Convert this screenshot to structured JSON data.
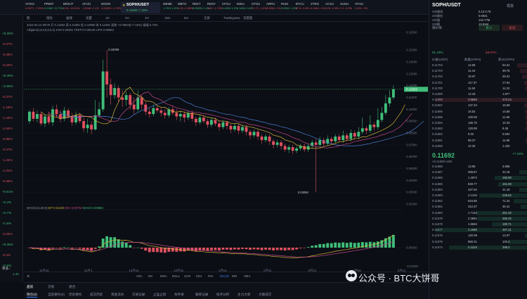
{
  "tabs": [
    {
      "name": "AITKO",
      "chg": "0.0971 -7.59%",
      "active": false
    },
    {
      "name": "PRIMT",
      "chg": "0.1462 +0.71%",
      "active": false
    },
    {
      "name": "BRZUT",
      "chg": "0.00 -13.91%",
      "active": false
    },
    {
      "name": "ATA/U",
      "chg": "1.3048 -1.1%",
      "active": false
    },
    {
      "name": "MOON",
      "chg": "0.00293 -1.79%",
      "active": false
    },
    {
      "name": "SOPH/USDT",
      "chg": "0.11692 7.16%",
      "active": true
    },
    {
      "name": "MEME",
      "chg": "1.76% 1.0%",
      "active": false
    },
    {
      "name": "MBTO",
      "chg": "1.25 -0.38%",
      "active": false
    },
    {
      "name": "REKT",
      "chg": "0.55000 1.4%",
      "active": false
    },
    {
      "name": "RENY",
      "chg": "1.10 -1.79%",
      "active": false
    },
    {
      "name": "CFXU",
      "chg": "1.4094 1.2%",
      "active": false
    },
    {
      "name": "IMSU",
      "chg": "1.1604 1.6%",
      "active": false
    },
    {
      "name": "OTOU",
      "chg": "71.71 -1.0%",
      "active": false
    },
    {
      "name": "ARPU",
      "chg": "0.0004 -1%",
      "active": false
    },
    {
      "name": "RUM",
      "chg": "0.3002 1.0%",
      "active": false
    },
    {
      "name": "BTCU",
      "chg": "87.6 -0.6%",
      "active": false
    },
    {
      "name": "STRO",
      "chg": "0.0481 -1%",
      "active": false
    },
    {
      "name": "ACXU",
      "chg": "0.01 -0.8%",
      "active": false
    },
    {
      "name": "SUSU",
      "chg": "1.1 -0.9%",
      "active": false
    },
    {
      "name": "ATA/U",
      "chg": "0.001 -2%",
      "active": false
    }
  ],
  "pair": {
    "name": "SOPH/USDT",
    "price": "0.11692",
    "change": "7.16%"
  },
  "left_list": [
    "+0.28%",
    "-0.37%",
    "-0.48%",
    "-0.22%",
    "+0.45%",
    "+2.85%",
    "-0.37%",
    "-1.16%",
    "-1.44%",
    "-1.64%",
    "-0.95%",
    "-0.27%",
    "-1.22%",
    "-1.01%",
    "-0.35%",
    "+0.61%",
    "+2.4%",
    "+2.7%",
    "+1.8%",
    "-0.42%",
    "+0.35%",
    "-0.4%",
    "+2.6%"
  ],
  "left_bottom": {
    "label": "参多↓",
    "value": "1.41"
  },
  "toolbar": {
    "items": [
      "图",
      "指标",
      "画线",
      "设置",
      "1D",
      "4H",
      "1H",
      "15m",
      "5m",
      "全屏",
      "Tradingview",
      "深度图"
    ]
  },
  "ohlc": {
    "line1": "2024-03-12 09:00  开 0.11692  高 0.11692  低 0.10980  收 0.11692  涨跌 +0.00833(+7.16%)  振幅 5.73%",
    "line2": "Alligator(13,8,5,8,5,3)  JAW 0.09481  TEETH 0.09126  LIPS 0.09663"
  },
  "chart_data": {
    "type": "candlestick",
    "ylabels": [
      "0.16500",
      "0.15000",
      "0.14000",
      "0.13000",
      "0.12000",
      "0.11000",
      "0.10000",
      "0.09000",
      "0.08000",
      "0.07000",
      "0.06000",
      "0.05000",
      "0.04000",
      "0.03000",
      "0.02000"
    ],
    "xlabels": [
      "11月16",
      "12月1",
      "12月16",
      "12月31",
      "1月16",
      "1月31",
      "2月14",
      "2月26",
      "3月12"
    ],
    "high_label": "0.15009",
    "low_label": "0.03050",
    "last_price": "0.11692",
    "candles": [
      [
        0.09,
        0.098,
        0.088,
        0.099
      ],
      [
        0.098,
        0.092,
        0.09,
        0.101
      ],
      [
        0.092,
        0.096,
        0.089,
        0.099
      ],
      [
        0.096,
        0.088,
        0.086,
        0.098
      ],
      [
        0.088,
        0.094,
        0.085,
        0.096
      ],
      [
        0.094,
        0.089,
        0.087,
        0.097
      ],
      [
        0.089,
        0.1,
        0.086,
        0.103
      ],
      [
        0.1,
        0.096,
        0.093,
        0.104
      ],
      [
        0.096,
        0.092,
        0.089,
        0.099
      ],
      [
        0.092,
        0.099,
        0.09,
        0.102
      ],
      [
        0.099,
        0.094,
        0.092,
        0.101
      ],
      [
        0.094,
        0.089,
        0.086,
        0.097
      ],
      [
        0.089,
        0.095,
        0.087,
        0.098
      ],
      [
        0.095,
        0.09,
        0.088,
        0.097
      ],
      [
        0.09,
        0.084,
        0.081,
        0.093
      ],
      [
        0.084,
        0.087,
        0.08,
        0.092
      ],
      [
        0.087,
        0.083,
        0.079,
        0.09
      ],
      [
        0.083,
        0.095,
        0.082,
        0.108
      ],
      [
        0.095,
        0.1,
        0.093,
        0.106
      ],
      [
        0.1,
        0.132,
        0.098,
        0.142
      ],
      [
        0.132,
        0.121,
        0.11,
        0.15
      ],
      [
        0.121,
        0.112,
        0.104,
        0.126
      ],
      [
        0.112,
        0.118,
        0.109,
        0.122
      ],
      [
        0.118,
        0.11,
        0.106,
        0.12
      ],
      [
        0.11,
        0.108,
        0.102,
        0.116
      ],
      [
        0.108,
        0.112,
        0.103,
        0.115
      ],
      [
        0.112,
        0.104,
        0.1,
        0.114
      ],
      [
        0.104,
        0.1,
        0.096,
        0.11
      ],
      [
        0.1,
        0.11,
        0.098,
        0.116
      ],
      [
        0.11,
        0.104,
        0.1,
        0.112
      ],
      [
        0.104,
        0.098,
        0.095,
        0.106
      ],
      [
        0.098,
        0.096,
        0.093,
        0.101
      ],
      [
        0.096,
        0.101,
        0.094,
        0.104
      ],
      [
        0.101,
        0.099,
        0.097,
        0.103
      ],
      [
        0.099,
        0.097,
        0.094,
        0.102
      ],
      [
        0.097,
        0.095,
        0.092,
        0.1
      ],
      [
        0.095,
        0.1,
        0.093,
        0.102
      ],
      [
        0.1,
        0.097,
        0.095,
        0.103
      ],
      [
        0.097,
        0.094,
        0.091,
        0.1
      ],
      [
        0.094,
        0.096,
        0.09,
        0.099
      ],
      [
        0.096,
        0.093,
        0.089,
        0.098
      ],
      [
        0.093,
        0.097,
        0.091,
        0.099
      ],
      [
        0.097,
        0.092,
        0.09,
        0.099
      ],
      [
        0.092,
        0.089,
        0.086,
        0.094
      ],
      [
        0.089,
        0.093,
        0.087,
        0.096
      ],
      [
        0.093,
        0.09,
        0.088,
        0.095
      ],
      [
        0.09,
        0.087,
        0.084,
        0.092
      ],
      [
        0.087,
        0.091,
        0.085,
        0.093
      ],
      [
        0.091,
        0.088,
        0.086,
        0.093
      ],
      [
        0.088,
        0.085,
        0.082,
        0.09
      ],
      [
        0.085,
        0.089,
        0.083,
        0.091
      ],
      [
        0.089,
        0.086,
        0.083,
        0.09
      ],
      [
        0.086,
        0.083,
        0.08,
        0.088
      ],
      [
        0.083,
        0.086,
        0.081,
        0.088
      ],
      [
        0.086,
        0.082,
        0.079,
        0.088
      ],
      [
        0.082,
        0.085,
        0.08,
        0.087
      ],
      [
        0.085,
        0.081,
        0.078,
        0.087
      ],
      [
        0.081,
        0.078,
        0.075,
        0.083
      ],
      [
        0.078,
        0.081,
        0.076,
        0.083
      ],
      [
        0.081,
        0.077,
        0.074,
        0.083
      ],
      [
        0.077,
        0.074,
        0.071,
        0.079
      ],
      [
        0.074,
        0.077,
        0.072,
        0.079
      ],
      [
        0.077,
        0.073,
        0.07,
        0.079
      ],
      [
        0.073,
        0.07,
        0.067,
        0.075
      ],
      [
        0.07,
        0.072,
        0.068,
        0.074
      ],
      [
        0.072,
        0.069,
        0.066,
        0.074
      ],
      [
        0.069,
        0.066,
        0.064,
        0.071
      ],
      [
        0.066,
        0.068,
        0.063,
        0.07
      ],
      [
        0.068,
        0.065,
        0.062,
        0.07
      ],
      [
        0.065,
        0.067,
        0.063,
        0.069
      ],
      [
        0.067,
        0.069,
        0.065,
        0.071
      ],
      [
        0.069,
        0.066,
        0.064,
        0.071
      ],
      [
        0.066,
        0.069,
        0.064,
        0.071
      ],
      [
        0.069,
        0.072,
        0.067,
        0.074
      ],
      [
        0.072,
        0.07,
        0.03,
        0.075
      ],
      [
        0.07,
        0.074,
        0.068,
        0.077
      ],
      [
        0.074,
        0.071,
        0.069,
        0.076
      ],
      [
        0.071,
        0.075,
        0.069,
        0.078
      ],
      [
        0.075,
        0.073,
        0.07,
        0.077
      ],
      [
        0.073,
        0.077,
        0.071,
        0.079
      ],
      [
        0.077,
        0.074,
        0.072,
        0.079
      ],
      [
        0.074,
        0.078,
        0.072,
        0.082
      ],
      [
        0.078,
        0.075,
        0.073,
        0.08
      ],
      [
        0.075,
        0.08,
        0.073,
        0.083
      ],
      [
        0.08,
        0.077,
        0.074,
        0.082
      ],
      [
        0.077,
        0.081,
        0.075,
        0.085
      ],
      [
        0.081,
        0.084,
        0.079,
        0.093
      ],
      [
        0.084,
        0.082,
        0.079,
        0.086
      ],
      [
        0.082,
        0.087,
        0.08,
        0.095
      ],
      [
        0.087,
        0.085,
        0.082,
        0.089
      ],
      [
        0.085,
        0.091,
        0.083,
        0.101
      ],
      [
        0.091,
        0.097,
        0.089,
        0.102
      ],
      [
        0.097,
        0.105,
        0.095,
        0.112
      ],
      [
        0.105,
        0.11,
        0.102,
        0.116
      ],
      [
        0.11,
        0.117,
        0.108,
        0.12
      ]
    ],
    "macd": {
      "label": "MACD(12,26,9)",
      "dif": "DIF 0.01193",
      "dea": "DEA 0.00762",
      "macd": "MACD 0.00863",
      "axis": [
        "0.00000",
        "-0.01000"
      ]
    }
  },
  "indicators": {
    "items": [
      "VOL",
      "MA",
      "EMA",
      "BOLL",
      "SAR",
      "KDJ",
      "RSI",
      "MACD",
      "WR",
      "OBV"
    ],
    "active": "MACD"
  },
  "bottom_tabs": [
    "持仓(0)",
    "当前委托(0)",
    "历史委托",
    "成交历史",
    "资金流水",
    "交易记录",
    "止盈止损",
    "条件单",
    "跟单记录",
    "技术分析",
    "主力大单",
    "大额成交"
  ],
  "bottom_right_tabs": [
    "盘前",
    "交易",
    "组合"
  ],
  "orderbook": {
    "pair": "SOPH/USDT",
    "tag": "现货",
    "stats": [
      {
        "k": "24h最高",
        "v": "0.13 0.75"
      },
      {
        "k": "24h最低",
        "v": "0.0931"
      },
      {
        "k": "24h量",
        "v": "134.77M"
      },
      {
        "k": "24h额",
        "v": "13.91M"
      }
    ],
    "header": [
      "价格(USDT)",
      "数量(SOPH)",
      "累计(SOPH)"
    ],
    "asks": [
      [
        "0.11704",
        "14.56",
        "54.31"
      ],
      [
        "0.11703",
        "11.44",
        "39.75"
      ],
      [
        "0.11702",
        "10.67",
        "28.31"
      ],
      [
        "0.11701",
        "117.37",
        "17.64"
      ],
      [
        "0.11700",
        "11.63",
        "11.23"
      ],
      [
        "0.11699",
        "12.43",
        "1.877"
      ],
      [
        "0.11698",
        "3.9846",
        "473.24"
      ],
      [
        "0.11697",
        "137.43",
        "16.69"
      ],
      [
        "0.11696",
        "16.52",
        "14.56"
      ],
      [
        "0.11695",
        "100.06",
        "11.68"
      ],
      [
        "0.11694",
        "136.75",
        "10.43"
      ],
      [
        "0.11693",
        "120.99",
        "9.45"
      ],
      [
        "0.11692",
        "0.02",
        "0.002"
      ],
      [
        "0.11691",
        "98.37",
        "11.98"
      ],
      [
        "0.11690",
        "12.34",
        "1.432"
      ]
    ],
    "mid": {
      "price": "0.11692",
      "sub": "≈0.11692 USD",
      "chg": "+7.16%"
    },
    "bids": [
      [
        "0.11688",
        "13.96",
        "3.996"
      ],
      [
        "0.11687",
        "269.67",
        "42.16"
      ],
      [
        "0.11686",
        "1.4974",
        "166.90"
      ],
      [
        "0.11685",
        "848.77",
        "151.60"
      ],
      [
        "0.11684",
        "427.62",
        "41.18"
      ],
      [
        "0.11683",
        "2.1416",
        "245.62"
      ],
      [
        "0.11682",
        "615.85",
        "71.24"
      ],
      [
        "0.11681",
        "312.37",
        "36.41"
      ],
      [
        "0.11680",
        "1.7134",
        "261.20"
      ],
      [
        "0.11679",
        "2.3694",
        "255.32"
      ],
      [
        "0.11678",
        "1.6846",
        "180.71"
      ],
      [
        "0.11677",
        "4.1666",
        "467.31"
      ],
      [
        "0.11676",
        "120.39",
        "14.07"
      ],
      [
        "0.11675",
        "860.31",
        "100.4"
      ],
      [
        "0.11674",
        "3.4216",
        "399.3"
      ]
    ],
    "ratio": {
      "buy": "51.43%",
      "sell": "48.57%"
    },
    "buy_label": "买入",
    "sell_label": "卖出",
    "limit_label": "限价单"
  },
  "watermark": "公众号 · BTC大饼哥",
  "colors": {
    "up": "#3fbf7a",
    "down": "#e05060",
    "jaw": "#4a7bd0",
    "teeth": "#c0468a",
    "lips": "#d4b13a",
    "bg": "#0b0e14"
  }
}
